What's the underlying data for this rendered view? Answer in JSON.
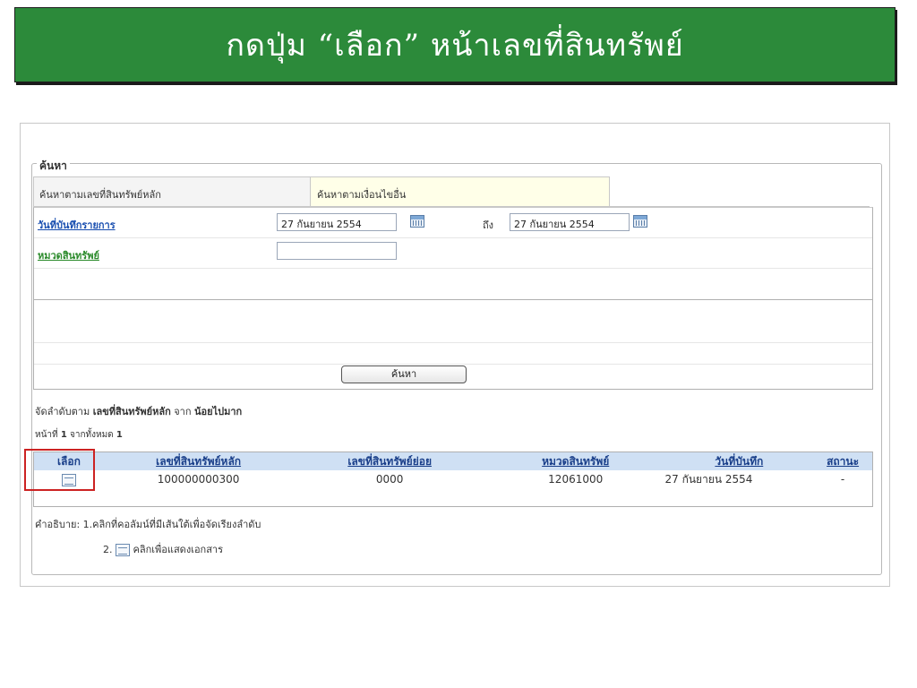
{
  "banner": {
    "title": "กดปุ่ม “เลือก” หน้าเลขที่สินทรัพย์",
    "bg_color": "#2c8a3a"
  },
  "search": {
    "legend": "ค้นหา",
    "tabs": [
      "ค้นหาตามเลขที่สินทรัพย์หลัก",
      "ค้นหาตามเงื่อนไขอื่น"
    ],
    "date_label": "วันที่บันทึกรายการ",
    "date_from": "27 กันยายน 2554",
    "to_label": "ถึง",
    "date_to": "27 กันยายน 2554",
    "category_label": "หมวดสินทรัพย์",
    "category_value": "",
    "search_button": "ค้นหา"
  },
  "results": {
    "sort_prefix": "จัดลำดับตาม",
    "sort_field": "เลขที่สินทรัพย์หลัก",
    "sort_mid": "จาก",
    "sort_order": "น้อยไปมาก",
    "page_prefix": "หน้าที่",
    "page_num": "1",
    "page_mid": "จากทั้งหมด",
    "page_total": "1",
    "columns": [
      "เลือก",
      "เลขที่สินทรัพย์หลัก",
      "เลขที่สินทรัพย์ย่อย",
      "หมวดสินทรัพย์",
      "วันที่บันทึก",
      "สถานะ"
    ],
    "rows": [
      {
        "main_no": "100000000300",
        "sub_no": "0000",
        "category": "12061000",
        "date": "27 กันยายน 2554",
        "status": "-"
      }
    ],
    "note_prefix": "คำอธิบาย:",
    "note1": "1.คลิกที่คอลัมน์ที่มีเส้นใต้เพื่อจัดเรียงลำดับ",
    "note2_num": "2.",
    "note2": "คลิกเพื่อแสดงเอกสาร",
    "highlight_color": "#cc2222"
  }
}
